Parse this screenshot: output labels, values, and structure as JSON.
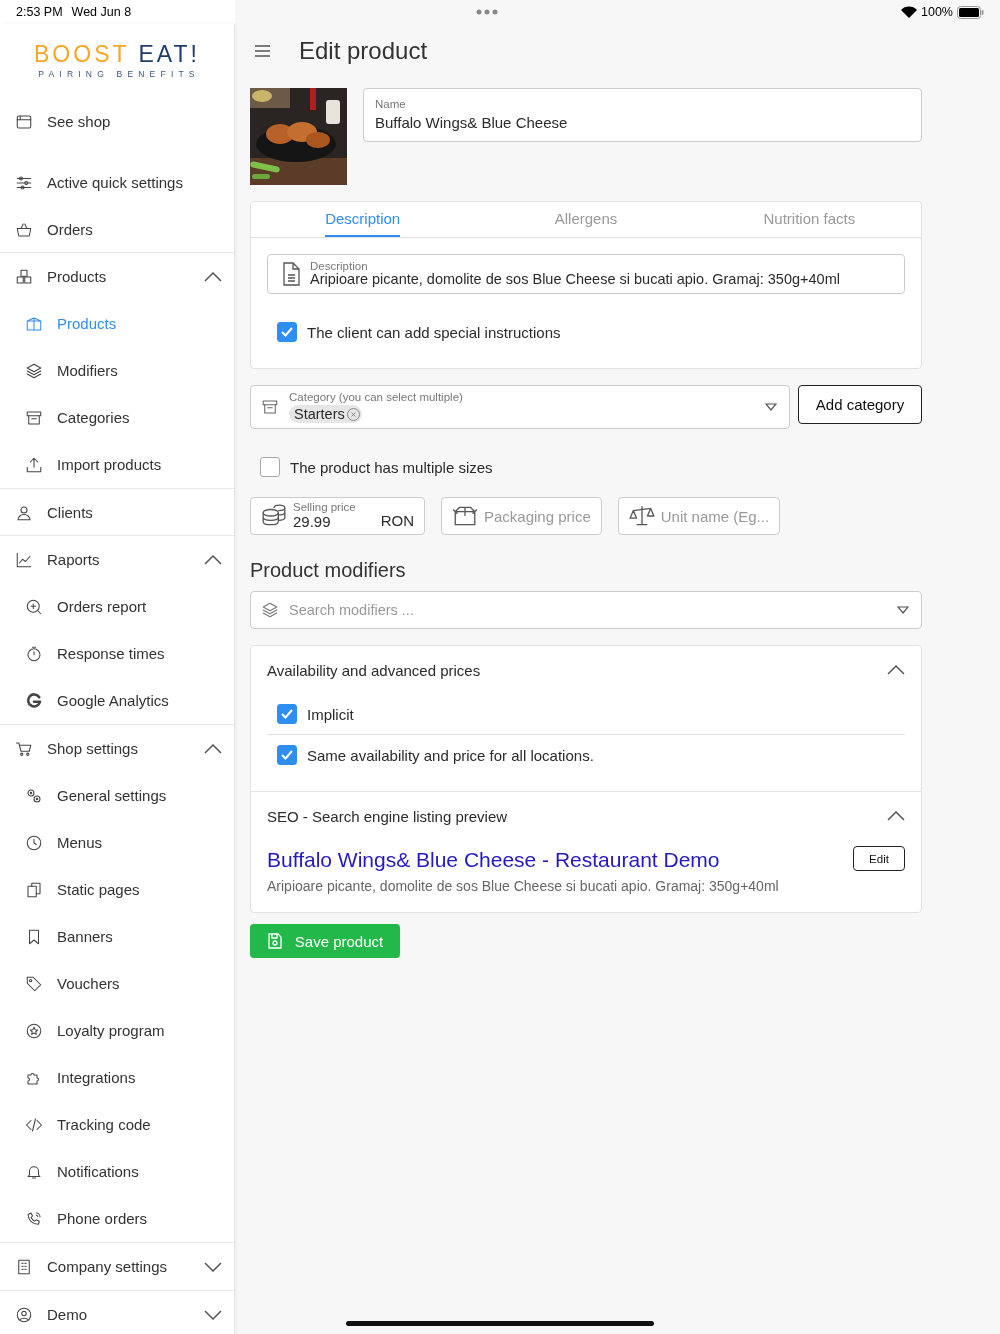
{
  "status_bar": {
    "time": "2:53 PM",
    "date": "Wed Jun 8",
    "battery": "100%"
  },
  "logo": {
    "word_1": "BOOST",
    "word_2": "EAT!",
    "tagline": "PAIRING BENEFITS"
  },
  "sidebar": {
    "items": [
      {
        "label": "See shop",
        "selected": false
      },
      {
        "label": "Active quick settings",
        "selected": false
      },
      {
        "label": "Orders",
        "selected": false
      },
      {
        "label": "Products",
        "selected": false,
        "expanded": true,
        "children": [
          {
            "label": "Products",
            "selected": true
          },
          {
            "label": "Modifiers",
            "selected": false
          },
          {
            "label": "Categories",
            "selected": false
          },
          {
            "label": "Import products",
            "selected": false
          }
        ]
      },
      {
        "label": "Clients",
        "selected": false
      },
      {
        "label": "Raports",
        "selected": false,
        "expanded": true,
        "children": [
          {
            "label": "Orders report",
            "selected": false
          },
          {
            "label": "Response times",
            "selected": false
          },
          {
            "label": "Google Analytics",
            "selected": false
          }
        ]
      },
      {
        "label": "Shop settings",
        "selected": false,
        "expanded": true,
        "children": [
          {
            "label": "General settings",
            "selected": false
          },
          {
            "label": "Menus",
            "selected": false
          },
          {
            "label": "Static pages",
            "selected": false
          },
          {
            "label": "Banners",
            "selected": false
          },
          {
            "label": "Vouchers",
            "selected": false
          },
          {
            "label": "Loyalty program",
            "selected": false
          },
          {
            "label": "Integrations",
            "selected": false
          },
          {
            "label": "Tracking code",
            "selected": false
          },
          {
            "label": "Notifications",
            "selected": false
          },
          {
            "label": "Phone orders",
            "selected": false
          }
        ]
      },
      {
        "label": "Company settings",
        "selected": false,
        "expanded": false
      },
      {
        "label": "Demo",
        "selected": false,
        "expanded": false
      }
    ]
  },
  "header": {
    "title": "Edit product"
  },
  "product": {
    "name": {
      "label": "Name",
      "value": "Buffalo Wings& Blue Cheese"
    }
  },
  "tabs": [
    {
      "label": "Description",
      "selected": true
    },
    {
      "label": "Allergens",
      "selected": false
    },
    {
      "label": "Nutrition facts",
      "selected": false
    }
  ],
  "description": {
    "label": "Description",
    "value": "Aripioare picante, domolite de sos Blue Cheese si bucati apio. Gramaj: 350g+40ml"
  },
  "special_instructions": {
    "label": "The client can add special instructions",
    "checked": true
  },
  "category": {
    "label": "Category (you can select multiple)",
    "tags": [
      "Starters"
    ],
    "add_button": "Add category"
  },
  "multiple_sizes": {
    "label": "The product has multiple sizes",
    "checked": false
  },
  "prices": [
    {
      "kind": "value",
      "label": "Selling price",
      "value": "29.99",
      "unit": "RON"
    },
    {
      "kind": "empty",
      "placeholder": "Packaging price"
    },
    {
      "kind": "empty",
      "placeholder": "Unit name (Eg..."
    }
  ],
  "modifiers": {
    "title": "Product modifiers",
    "search": {
      "placeholder": "Search modifiers ..."
    }
  },
  "availability": {
    "title": "Availability and advanced prices",
    "expanded": true,
    "options": [
      {
        "label": "Implicit",
        "checked": true
      },
      {
        "label": "Same availability and price for all locations.",
        "checked": true
      }
    ]
  },
  "seo": {
    "title": "SEO - Search engine listing preview",
    "expanded": true,
    "link": "Buffalo Wings& Blue Cheese - Restaurant Demo",
    "description": "Aripioare picante, domolite de sos Blue Cheese si bucati apio. Gramaj: 350g+40ml",
    "edit_button": "Edit"
  },
  "save_button": "Save product"
}
